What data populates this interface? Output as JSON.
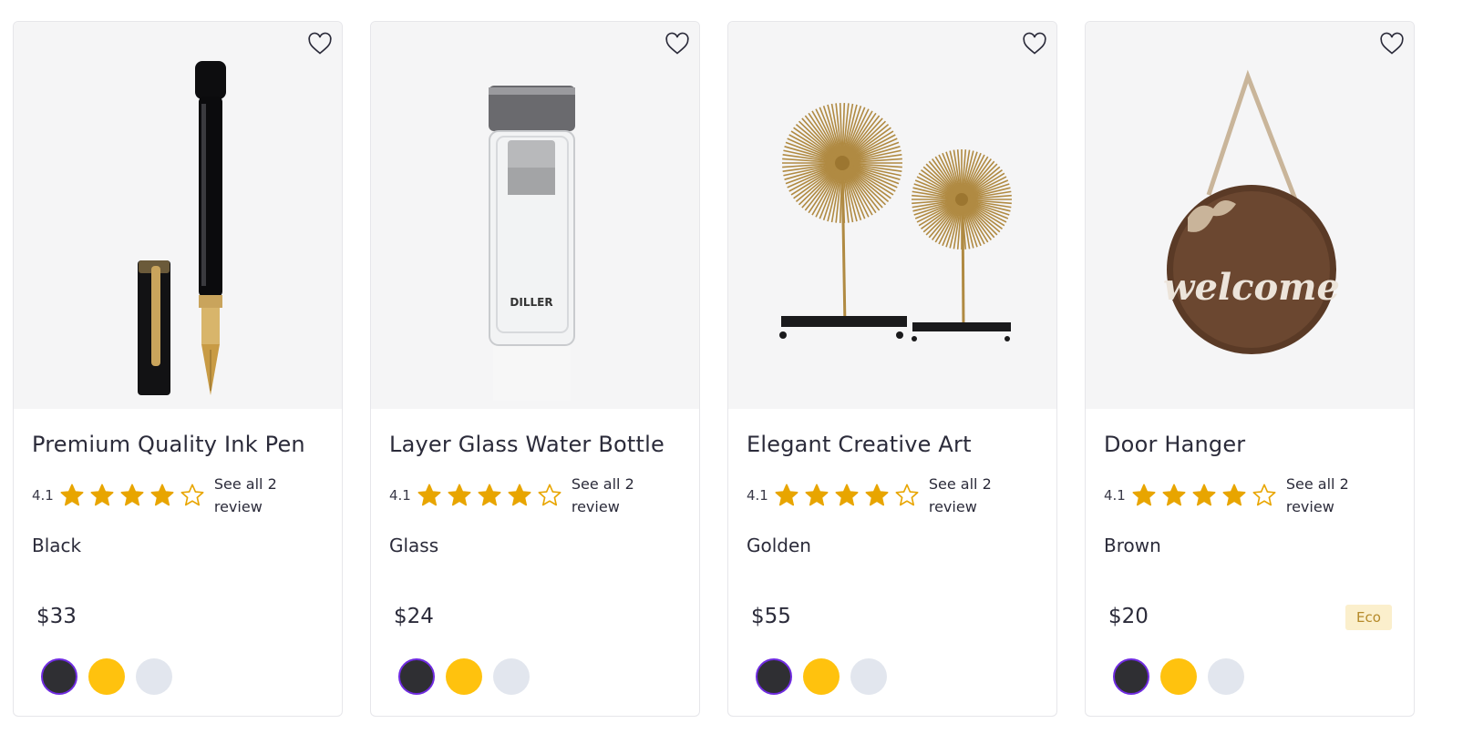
{
  "products": [
    {
      "name": "Premium Quality Ink Pen",
      "rating": "4.1",
      "stars_filled": 4,
      "stars_total": 5,
      "reviews": "See all 2 review",
      "color": "Black",
      "price": "$33",
      "badge": "",
      "swatches": [
        "#2f2f33",
        "#ffc20e",
        "#e2e6ee"
      ],
      "selected_swatch": 0,
      "image": "fountain-pen-image"
    },
    {
      "name": "Layer Glass Water Bottle",
      "rating": "4.1",
      "stars_filled": 4,
      "stars_total": 5,
      "reviews": "See all 2 review",
      "color": "Glass",
      "price": "$24",
      "badge": "",
      "swatches": [
        "#2f2f33",
        "#ffc20e",
        "#e2e6ee"
      ],
      "selected_swatch": 0,
      "image": "glass-bottle-image",
      "image_text": "DILLER"
    },
    {
      "name": "Elegant Creative Art",
      "rating": "4.1",
      "stars_filled": 4,
      "stars_total": 5,
      "reviews": "See all 2 review",
      "color": "Golden",
      "price": "$55",
      "badge": "",
      "swatches": [
        "#2f2f33",
        "#ffc20e",
        "#e2e6ee"
      ],
      "selected_swatch": 0,
      "image": "sculpture-image"
    },
    {
      "name": "Door Hanger",
      "rating": "4.1",
      "stars_filled": 4,
      "stars_total": 5,
      "reviews": "See all 2 review",
      "color": "Brown",
      "price": "$20",
      "badge": "Eco",
      "swatches": [
        "#2f2f33",
        "#ffc20e",
        "#e2e6ee"
      ],
      "selected_swatch": 0,
      "image": "door-hanger-image",
      "image_text": "welcome"
    }
  ],
  "colors": {
    "star": "#e8a500",
    "selected_ring": "#6f2be0",
    "badge_bg": "#fbefcc",
    "badge_text": "#b58a2a"
  }
}
